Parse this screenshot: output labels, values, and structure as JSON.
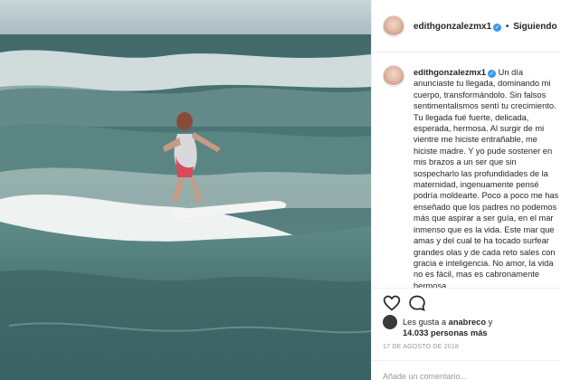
{
  "post": {
    "username": "edithgonzalezmx1",
    "follow_status": "Siguiendo",
    "separator": "•",
    "caption": "Un día anunciaste tu llegada, dominando mi cuerpo, transformándolo. Sin falsos sentimentalismos sentí tu crecimiento. Tu llegada fué fuerte, delicada, esperada, hermosa. Al surgir de mi vientre me hiciste entrañable, me hiciste madre. Y yo pude sostener en mis brazos a un ser que sin sospecharlo las profundidades de la maternidad, ingenuamente pensé podría moldearte. Poco a poco me has enseñado que los padres no podemos más que aspirar a ser guía, en el mar inmenso que es la vida. Este mar que amas y del cual te ha tocado surfear grandes olas y de cada reto sales con gracia e inteligencia. No amor, la vida no es fácil, mas es cabronamente hermosa.",
    "likes_prefix": "Les gusta a ",
    "likes_user": "anabreco",
    "likes_middle": " y ",
    "likes_count": "14.033 personas más",
    "date": "17 DE AGOSTO DE 2018",
    "add_comment_placeholder": "Añade un comentario..."
  },
  "icons": {
    "verified": "verified-badge-icon",
    "like": "heart-icon",
    "comment": "comment-bubble-icon"
  },
  "colors": {
    "verified_blue": "#3897f0",
    "border": "#efefef",
    "muted": "#999999",
    "text": "#262626"
  }
}
